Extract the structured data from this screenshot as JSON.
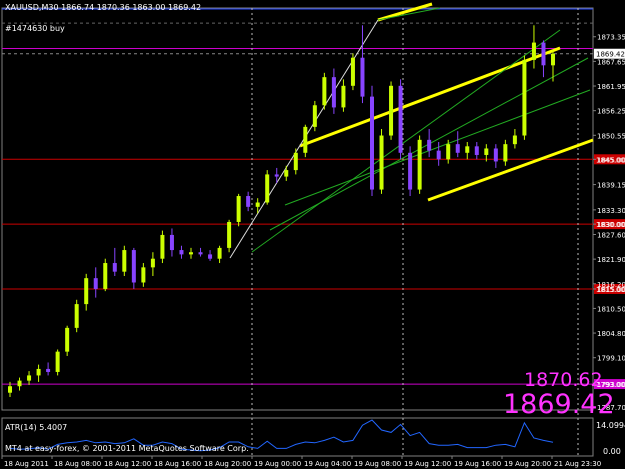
{
  "header": {
    "symbol_line": "XAUUSD,M30  1866.74 1870.36 1863.00 1869.42",
    "order_label": "#1474630 buy"
  },
  "big_prices": {
    "upper": "1870.62",
    "lower": "1869.42"
  },
  "indicator": {
    "label": "ATR(14) 5.4007",
    "axis_top": "14.0994",
    "axis_bottom": "0.00"
  },
  "footer": {
    "copyright": "MT4 at easy-forex, © 2001-2011 MetaQuotes Software Corp."
  },
  "colors": {
    "background": "#000000",
    "bull_candle": "#ccff00",
    "bear_candle": "#8844ff",
    "channel_line": "#ffff00",
    "level_red": "#cc0000",
    "level_magenta": "#cc00cc",
    "price_text": "#ff33ff",
    "axis_text": "#ffffff"
  },
  "chart_data": {
    "type": "candlestick",
    "symbol": "XAUUSD",
    "timeframe": "M30",
    "ylim": [
      1787.0,
      1880.0
    ],
    "y_ticks": [
      "1873.35",
      "1867.65",
      "1861.95",
      "1856.25",
      "1850.55",
      "1845.00",
      "1839.15",
      "1833.30",
      "1830.00",
      "1827.60",
      "1821.90",
      "1816.20",
      "1815.00",
      "1810.50",
      "1804.80",
      "1799.10",
      "1793.00",
      "1787.70"
    ],
    "current_price": "1869.42",
    "levels": [
      {
        "price": 1845.0,
        "label": "1845.00",
        "color": "#cc0000"
      },
      {
        "price": 1830.0,
        "label": "1830.00",
        "color": "#cc0000"
      },
      {
        "price": 1815.0,
        "label": "1815.00",
        "color": "#cc0000"
      },
      {
        "price": 1870.62,
        "label": "",
        "color": "#cc00cc"
      },
      {
        "price": 1793.0,
        "label": "1793.00",
        "color": "#cc00cc"
      }
    ],
    "x_labels": [
      "18 Aug 2011",
      "18 Aug 08:00",
      "18 Aug 12:00",
      "18 Aug 16:00",
      "18 Aug 20:00",
      "19 Aug 00:00",
      "19 Aug 04:00",
      "19 Aug 08:00",
      "19 Aug 12:00",
      "19 Aug 16:00",
      "19 Aug 20:00",
      "21 Aug 23:30"
    ],
    "separators": [
      2.5,
      5.5,
      10.5
    ],
    "candles": [
      {
        "o": 1791.0,
        "h": 1793.5,
        "l": 1790.0,
        "c": 1792.5
      },
      {
        "o": 1792.5,
        "h": 1794.5,
        "l": 1791.5,
        "c": 1793.8
      },
      {
        "o": 1793.8,
        "h": 1796.0,
        "l": 1792.8,
        "c": 1795.0
      },
      {
        "o": 1795.0,
        "h": 1797.5,
        "l": 1793.5,
        "c": 1796.5
      },
      {
        "o": 1796.5,
        "h": 1798.0,
        "l": 1795.0,
        "c": 1795.8
      },
      {
        "o": 1795.8,
        "h": 1801.0,
        "l": 1795.0,
        "c": 1800.5
      },
      {
        "o": 1800.5,
        "h": 1806.5,
        "l": 1799.5,
        "c": 1806.0
      },
      {
        "o": 1806.0,
        "h": 1812.5,
        "l": 1805.0,
        "c": 1811.5
      },
      {
        "o": 1811.5,
        "h": 1818.5,
        "l": 1810.0,
        "c": 1817.5
      },
      {
        "o": 1817.5,
        "h": 1820.0,
        "l": 1813.0,
        "c": 1815.0
      },
      {
        "o": 1815.0,
        "h": 1822.0,
        "l": 1814.5,
        "c": 1821.0
      },
      {
        "o": 1821.0,
        "h": 1824.5,
        "l": 1818.0,
        "c": 1819.0
      },
      {
        "o": 1819.0,
        "h": 1825.0,
        "l": 1818.0,
        "c": 1824.0
      },
      {
        "o": 1824.0,
        "h": 1824.5,
        "l": 1815.0,
        "c": 1816.5
      },
      {
        "o": 1816.5,
        "h": 1821.0,
        "l": 1815.5,
        "c": 1820.0
      },
      {
        "o": 1820.0,
        "h": 1823.5,
        "l": 1818.0,
        "c": 1822.0
      },
      {
        "o": 1822.0,
        "h": 1828.5,
        "l": 1821.0,
        "c": 1827.5
      },
      {
        "o": 1827.5,
        "h": 1829.0,
        "l": 1822.5,
        "c": 1824.0
      },
      {
        "o": 1824.0,
        "h": 1825.0,
        "l": 1822.0,
        "c": 1823.0
      },
      {
        "o": 1823.0,
        "h": 1824.5,
        "l": 1822.0,
        "c": 1823.5
      },
      {
        "o": 1823.5,
        "h": 1824.5,
        "l": 1822.5,
        "c": 1823.0
      },
      {
        "o": 1823.0,
        "h": 1824.0,
        "l": 1821.5,
        "c": 1822.0
      },
      {
        "o": 1822.0,
        "h": 1825.0,
        "l": 1821.0,
        "c": 1824.5
      },
      {
        "o": 1824.5,
        "h": 1831.0,
        "l": 1823.5,
        "c": 1830.5
      },
      {
        "o": 1830.5,
        "h": 1837.0,
        "l": 1829.5,
        "c": 1836.5
      },
      {
        "o": 1836.5,
        "h": 1837.5,
        "l": 1833.0,
        "c": 1834.0
      },
      {
        "o": 1834.0,
        "h": 1836.0,
        "l": 1832.5,
        "c": 1835.0
      },
      {
        "o": 1835.0,
        "h": 1842.5,
        "l": 1834.5,
        "c": 1841.5
      },
      {
        "o": 1841.5,
        "h": 1843.0,
        "l": 1839.5,
        "c": 1841.0
      },
      {
        "o": 1841.0,
        "h": 1843.5,
        "l": 1840.0,
        "c": 1842.5
      },
      {
        "o": 1842.5,
        "h": 1847.5,
        "l": 1841.5,
        "c": 1846.5
      },
      {
        "o": 1846.5,
        "h": 1853.0,
        "l": 1845.5,
        "c": 1852.5
      },
      {
        "o": 1852.5,
        "h": 1858.5,
        "l": 1851.5,
        "c": 1857.5
      },
      {
        "o": 1857.5,
        "h": 1865.0,
        "l": 1856.5,
        "c": 1864.0
      },
      {
        "o": 1864.0,
        "h": 1866.0,
        "l": 1855.5,
        "c": 1857.0
      },
      {
        "o": 1857.0,
        "h": 1863.5,
        "l": 1856.0,
        "c": 1862.0
      },
      {
        "o": 1862.0,
        "h": 1869.5,
        "l": 1861.0,
        "c": 1868.5
      },
      {
        "o": 1868.5,
        "h": 1876.0,
        "l": 1858.0,
        "c": 1859.5
      },
      {
        "o": 1859.5,
        "h": 1862.0,
        "l": 1836.5,
        "c": 1838.0
      },
      {
        "o": 1838.0,
        "h": 1852.0,
        "l": 1837.0,
        "c": 1850.5
      },
      {
        "o": 1850.5,
        "h": 1863.0,
        "l": 1849.5,
        "c": 1862.0
      },
      {
        "o": 1862.0,
        "h": 1863.5,
        "l": 1845.0,
        "c": 1846.5
      },
      {
        "o": 1846.5,
        "h": 1848.0,
        "l": 1836.5,
        "c": 1838.0
      },
      {
        "o": 1838.0,
        "h": 1850.5,
        "l": 1837.0,
        "c": 1849.5
      },
      {
        "o": 1849.5,
        "h": 1852.0,
        "l": 1845.5,
        "c": 1847.0
      },
      {
        "o": 1847.0,
        "h": 1849.0,
        "l": 1843.5,
        "c": 1845.0
      },
      {
        "o": 1845.0,
        "h": 1849.5,
        "l": 1844.0,
        "c": 1848.5
      },
      {
        "o": 1848.5,
        "h": 1851.5,
        "l": 1845.5,
        "c": 1846.5
      },
      {
        "o": 1846.5,
        "h": 1849.0,
        "l": 1845.0,
        "c": 1848.0
      },
      {
        "o": 1848.0,
        "h": 1849.0,
        "l": 1845.0,
        "c": 1846.0
      },
      {
        "o": 1846.0,
        "h": 1848.5,
        "l": 1844.5,
        "c": 1847.5
      },
      {
        "o": 1847.5,
        "h": 1848.5,
        "l": 1843.0,
        "c": 1844.5
      },
      {
        "o": 1844.5,
        "h": 1849.5,
        "l": 1843.5,
        "c": 1848.5
      },
      {
        "o": 1848.5,
        "h": 1852.0,
        "l": 1847.5,
        "c": 1850.5
      },
      {
        "o": 1850.5,
        "h": 1869.0,
        "l": 1849.5,
        "c": 1868.0
      },
      {
        "o": 1868.0,
        "h": 1876.0,
        "l": 1866.0,
        "c": 1872.0
      },
      {
        "o": 1872.0,
        "h": 1872.5,
        "l": 1864.0,
        "c": 1866.74
      },
      {
        "o": 1866.74,
        "h": 1870.36,
        "l": 1863.0,
        "c": 1869.42
      }
    ]
  }
}
